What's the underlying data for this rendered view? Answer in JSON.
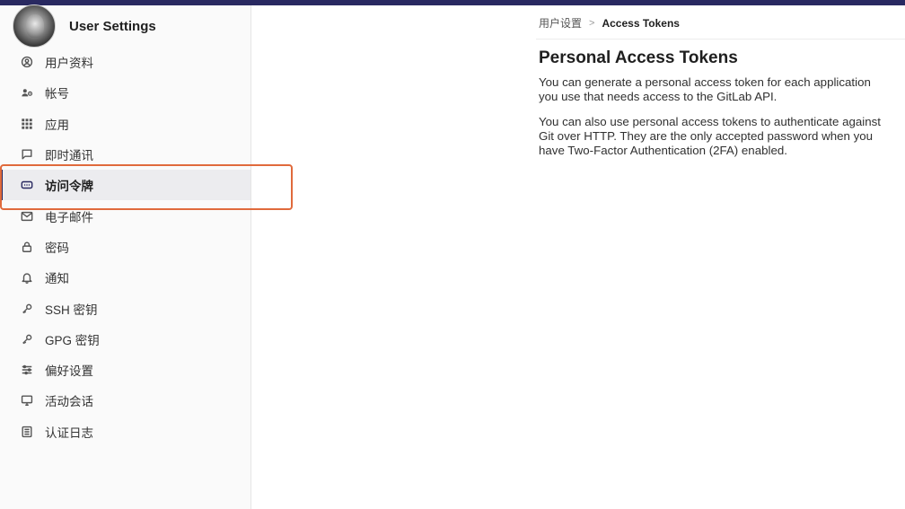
{
  "sidebar": {
    "title": "User Settings",
    "items": [
      {
        "label": "用户资料",
        "icon": "profile-icon"
      },
      {
        "label": "帐号",
        "icon": "account-icon"
      },
      {
        "label": "应用",
        "icon": "applications-icon"
      },
      {
        "label": "即时通讯",
        "icon": "chat-icon"
      },
      {
        "label": "访问令牌",
        "icon": "token-icon",
        "active": true
      },
      {
        "label": "电子邮件",
        "icon": "mail-icon"
      },
      {
        "label": "密码",
        "icon": "lock-icon"
      },
      {
        "label": "通知",
        "icon": "bell-icon"
      },
      {
        "label": "SSH 密钥",
        "icon": "key-icon"
      },
      {
        "label": "GPG 密钥",
        "icon": "key-icon"
      },
      {
        "label": "偏好设置",
        "icon": "preferences-icon"
      },
      {
        "label": "活动会话",
        "icon": "monitor-icon"
      },
      {
        "label": "认证日志",
        "icon": "log-icon"
      }
    ]
  },
  "breadcrumb": {
    "parent": "用户设置",
    "separator": ">",
    "current": "Access Tokens"
  },
  "main": {
    "title": "Personal Access Tokens",
    "paragraphs": [
      "You can generate a personal access token for each application you use that needs access to the GitLab API.",
      "You can also use personal access tokens to authenticate against Git over HTTP. They are the only accepted password when you have Two-Factor Authentication (2FA) enabled."
    ]
  },
  "colors": {
    "topbar": "#292961",
    "active_indicator": "#292961",
    "highlight_box": "#e06a3c"
  }
}
